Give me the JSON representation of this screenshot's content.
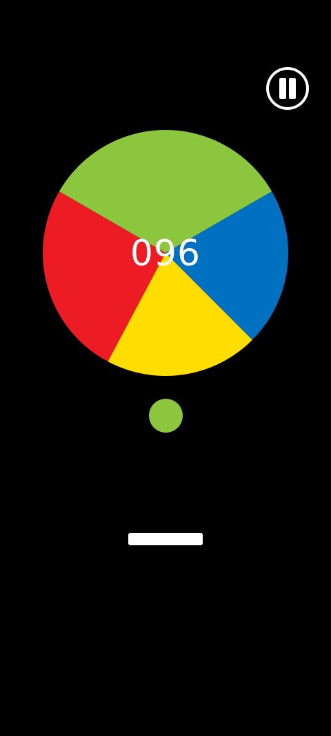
{
  "game": {
    "score": "096",
    "wheel": {
      "segments": [
        {
          "name": "green",
          "color": "#8cc63f",
          "start_deg": 0,
          "end_deg": 120
        },
        {
          "name": "blue",
          "color": "#0070c0",
          "start_deg": 120,
          "end_deg": 195
        },
        {
          "name": "yellow",
          "color": "#ffdd00",
          "start_deg": 195,
          "end_deg": 268
        },
        {
          "name": "red",
          "color": "#ed1c24",
          "start_deg": 268,
          "end_deg": 360
        }
      ]
    },
    "ball": {
      "color": "#8cc63f"
    },
    "paddle": {
      "color": "#ffffff"
    },
    "pause_icon": "pause-icon"
  }
}
